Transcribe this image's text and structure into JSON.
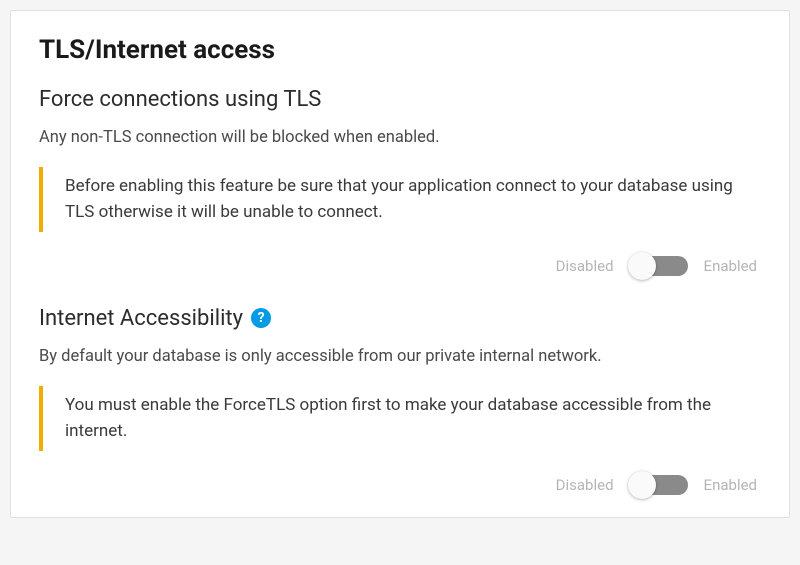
{
  "card": {
    "title": "TLS/Internet access"
  },
  "sections": {
    "tls": {
      "title": "Force connections using TLS",
      "description": "Any non-TLS connection will be blocked when enabled.",
      "warning": "Before enabling this feature be sure that your application connect to your database using TLS otherwise it will be unable to connect.",
      "toggle": {
        "left_label": "Disabled",
        "right_label": "Enabled",
        "state": "off"
      }
    },
    "internet": {
      "title": "Internet Accessibility",
      "description": "By default your database is only accessible from our private internal network.",
      "warning": "You must enable the ForceTLS option first to make your database accessible from the internet.",
      "toggle": {
        "left_label": "Disabled",
        "right_label": "Enabled",
        "state": "off"
      },
      "help_icon": "?"
    }
  }
}
